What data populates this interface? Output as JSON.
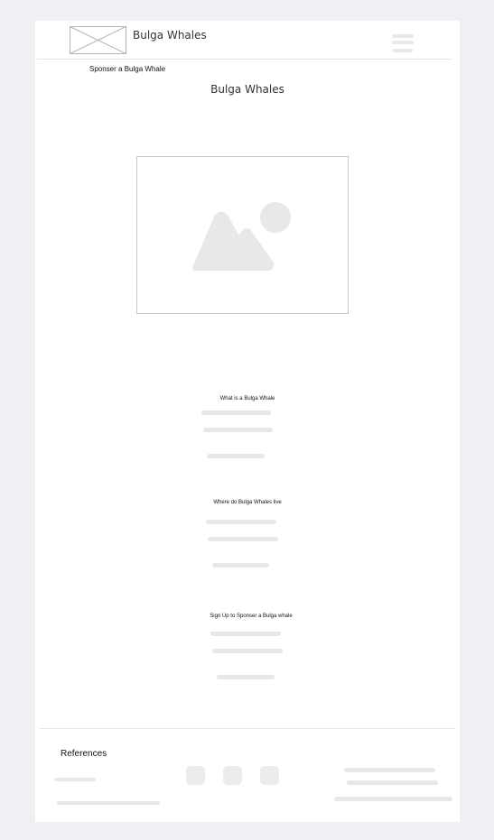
{
  "header": {
    "brand_name": "Bulga Whales",
    "logo": "image-placeholder-icon",
    "menu_icon": "hamburger-menu-icon"
  },
  "nav": {
    "sponsor_link": "Sponser a Bulga Whale"
  },
  "main": {
    "page_title": "Bulga Whales",
    "hero_image": "image-placeholder-icon",
    "sections": [
      {
        "title": "What is a Bulga Whale"
      },
      {
        "title": "Where do Bulga Whales live"
      },
      {
        "title": "Sign Up to Sponser a Bulga whale"
      }
    ]
  },
  "footer": {
    "references_label": "References",
    "social_icons": [
      "social-icon",
      "social-icon",
      "social-icon"
    ]
  },
  "colors": {
    "background": "#eef0f4",
    "page": "#ffffff",
    "placeholder": "#e8e8e8",
    "text": "#111111"
  }
}
